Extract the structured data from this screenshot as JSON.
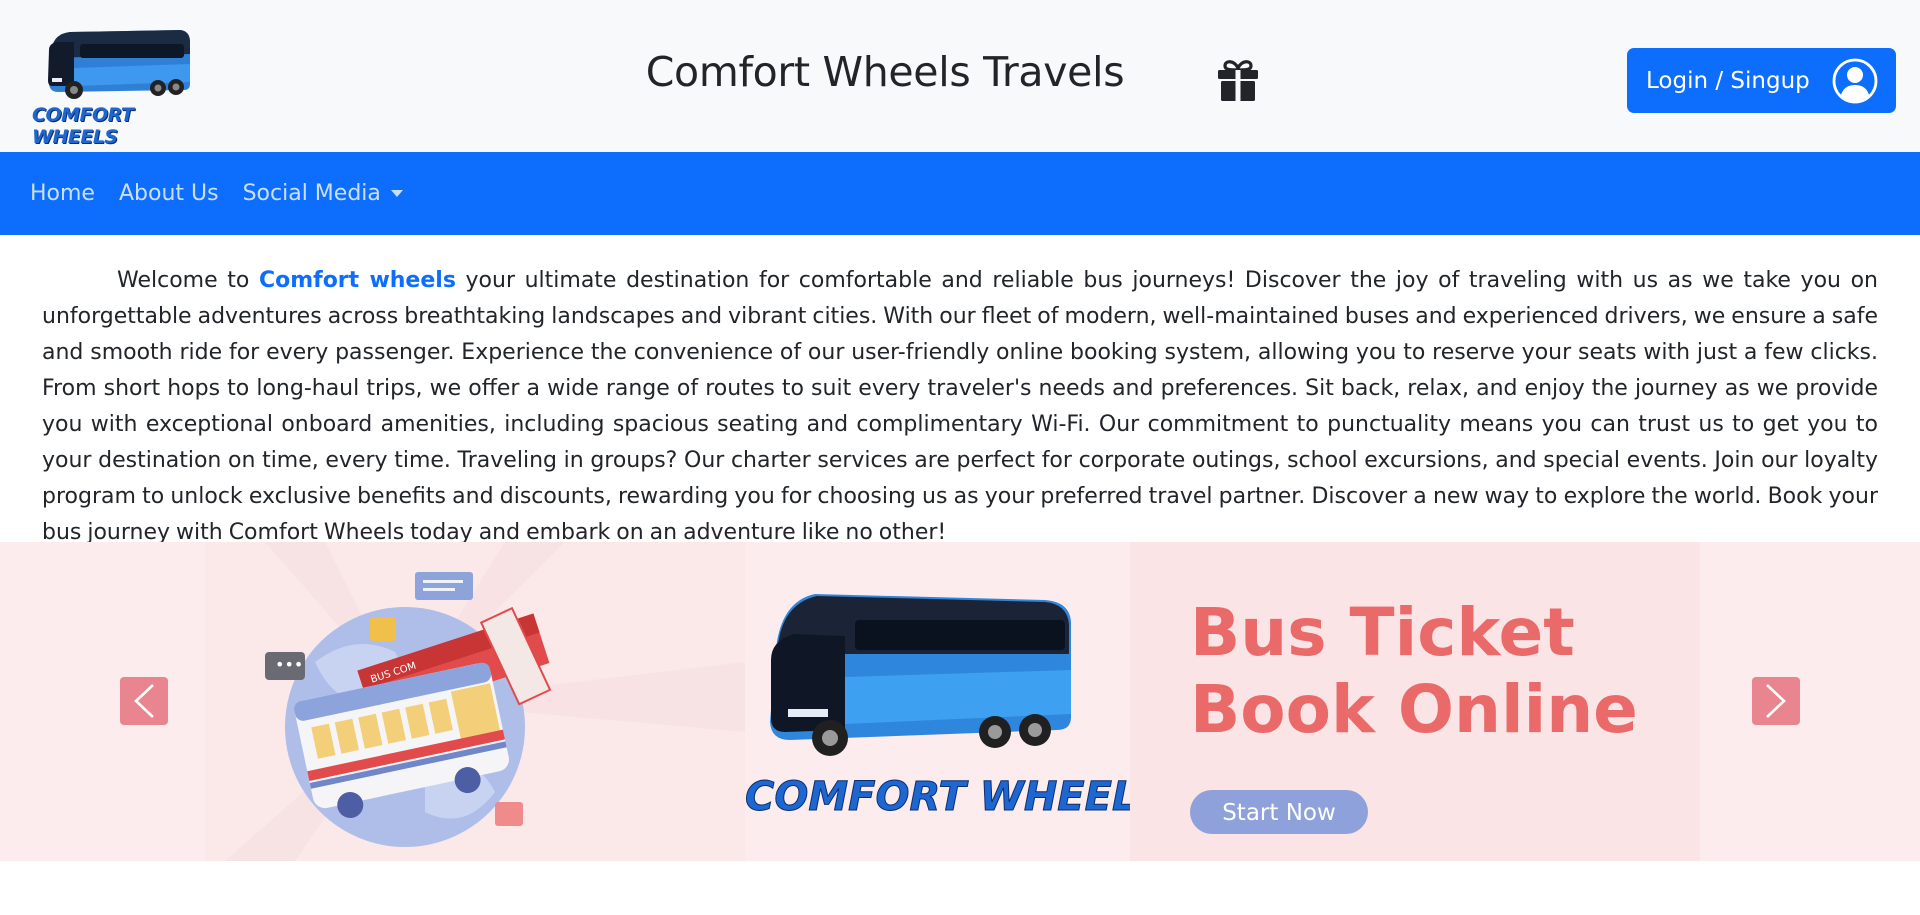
{
  "header": {
    "logo_text": "COMFORT WHEELS",
    "title": "Comfort Wheels Travels",
    "gift_icon": "gift-icon",
    "login_label": "Login / Singup",
    "user_icon": "user-circle-icon"
  },
  "nav": {
    "items": [
      {
        "label": "Home"
      },
      {
        "label": "About Us"
      },
      {
        "label": "Social Media"
      }
    ]
  },
  "intro": {
    "prefix": "Welcome to ",
    "brand": "Comfort wheels",
    "text": " your ultimate destination for comfortable and reliable bus journeys! Discover the joy of traveling with us as we take you on unforgettable adventures across breathtaking landscapes and vibrant cities. With our fleet of modern, well-maintained buses and experienced drivers, we ensure a safe and smooth ride for every passenger. Experience the convenience of our user-friendly online booking system, allowing you to reserve your seats with just a few clicks. From short hops to long-haul trips, we offer a wide range of routes to suit every traveler's needs and preferences. Sit back, relax, and enjoy the journey as we provide you with exceptional onboard amenities, including spacious seating and complimentary Wi-Fi. Our commitment to punctuality means you can trust us to get you to your destination on time, every time. Traveling in groups? Our charter services are perfect for corporate outings, school excursions, and special events. Join our loyalty program to unlock exclusive benefits and discounts, rewarding you for choosing us as your preferred travel partner. Discover a new way to explore the world. Book your bus journey with Comfort Wheels today and embark on an adventure like no other!"
  },
  "carousel": {
    "slide_logo_text": "COMFORT WHEELS",
    "headline_1": "Bus Ticket",
    "headline_2": "Book Online",
    "cta": "Start Now",
    "ticket_text": "BUS COM",
    "prev_icon": "chevron-left-icon",
    "next_icon": "chevron-right-icon"
  },
  "colors": {
    "primary": "#0d6efd",
    "header_bg": "#f8f9fa",
    "carousel_bg": "#fdeced",
    "headline": "#ea6a6a",
    "arrow": "#e8858e"
  }
}
